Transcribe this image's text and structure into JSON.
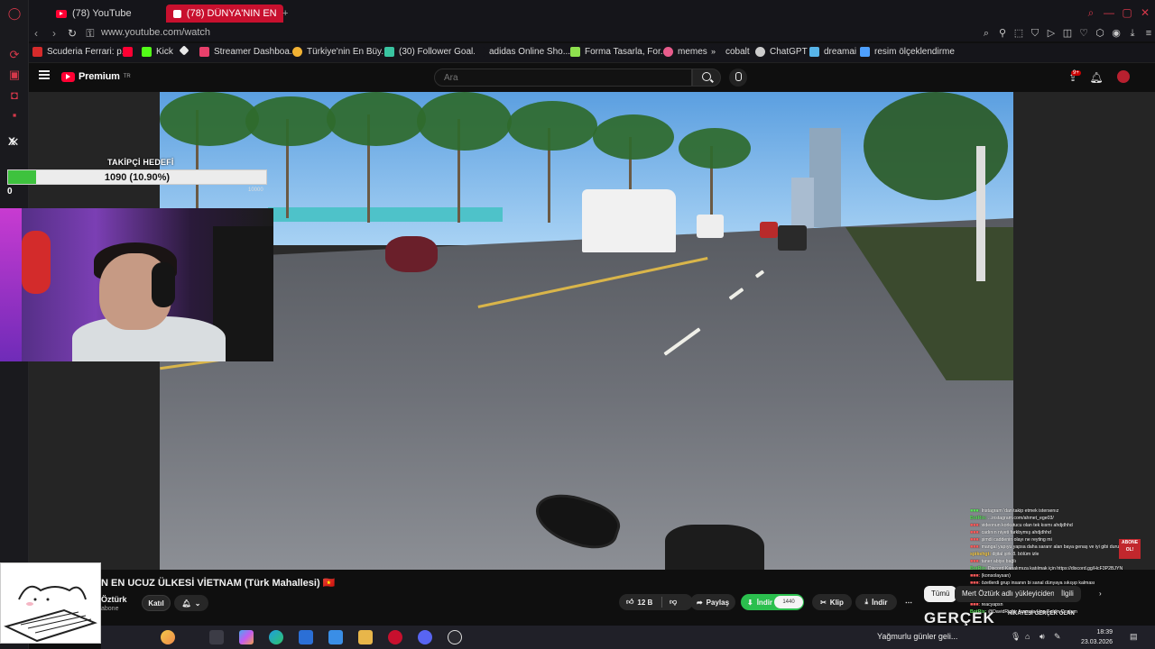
{
  "browser": {
    "tabs": [
      {
        "label": "(78) YouTube",
        "active": false
      },
      {
        "label": "(78) DÜNYA'NIN EN UCUZ",
        "active": true
      }
    ],
    "new_tab": "+",
    "url": "www.youtube.com/watch",
    "bookmarks": [
      {
        "label": "Scuderia Ferrari: p...",
        "color": "#d62b2b"
      },
      {
        "label": "",
        "color": "#ff0033"
      },
      {
        "label": "Kick",
        "color": "#53fc18"
      },
      {
        "label": "",
        "color": "#e8e8e8"
      },
      {
        "label": "Streamer Dashboa...",
        "color": "#e8406b"
      },
      {
        "label": "Türkiye'nin En Büy...",
        "color": "#f2b233"
      },
      {
        "label": "(30) Follower Goal...",
        "color": "#39c4a0"
      },
      {
        "label": "adidas Online Sho...",
        "color": "#111111"
      },
      {
        "label": "Forma Tasarla, For...",
        "color": "#8ee04e"
      },
      {
        "label": "memes",
        "color": "#e85c8c"
      },
      {
        "label": "cobalt",
        "color": "#dddddd"
      },
      {
        "label": "ChatGPT",
        "color": "#cccccc"
      },
      {
        "label": "dreamai",
        "color": "#57b4e8"
      },
      {
        "label": "resim ölçeklendirme",
        "color": "#4ea0ff"
      }
    ]
  },
  "youtube": {
    "logo_text": "Premium",
    "logo_sup": "TR",
    "search_placeholder": "Ara",
    "notif_count": "9+",
    "video": {
      "title": "N EN UCUZ ÜLKESİ VİETNAM (Türk Mahallesi) 🇻🇳",
      "channel": "Öztürk",
      "subs": "abone",
      "join_label": "Katıl",
      "likes": "12 B",
      "share_label": "Paylaş",
      "download_green_label": "İndir",
      "download_size": "1440",
      "clip_label": "Klip",
      "download_label": "İndir",
      "more_label": "⋯"
    },
    "chips": [
      "Tümü",
      "Mert Öztürk adlı yükleyiciden",
      "İlgili"
    ]
  },
  "overlay": {
    "goal_title": "TAKİPÇİ HEDEFİ",
    "goal_text": "1090 (10.90%)",
    "goal_fraction": 0.109,
    "goal_min": "0",
    "goal_max": "10000",
    "x_label": "X",
    "chat": [
      {
        "user": "",
        "text": "Instagram 'dan takip etmek istersenız",
        "color": "#5be05b"
      },
      {
        "user": "BotRix",
        "text": "...instagram.com/ahmet_ege03/",
        "color": "#5be05b"
      },
      {
        "user": "",
        "text": "videonun korkutucu olan tek kısmı ahdjdhhd",
        "color": "#ff5b5b"
      },
      {
        "user": "",
        "text": "cadının niyeti farkbymış ahdjdhhd",
        "color": "#ff5b5b"
      },
      {
        "user": "",
        "text": "şimdi caddenin olayı ne reyting mi",
        "color": "#ff5b5b"
      },
      {
        "user": "",
        "text": "mangal yapıyu yapsa daha sararır alan baya genaş ve iyi gibi duruyo",
        "color": "#ff5b5b"
      },
      {
        "user": "spikehgt",
        "text": "dijital şirk 8. bölüm izle",
        "color": "#ffd34d"
      },
      {
        "user": "",
        "text": "taner abiye bağlı",
        "color": "#ff5b5b"
      },
      {
        "user": "BotRix",
        "text": "Discord Kanalımıza katılmak için https://discord.gg/HcF3P2BJYN",
        "color": "#5be05b"
      },
      {
        "user": "",
        "text": "(konsolaysan)",
        "color": "#ff5b5b"
      },
      {
        "user": "",
        "text": "özetlerdi grup insanın bi sanal dünyaya sıkışıp kalması",
        "color": "#ff5b5b"
      },
      {
        "user": "",
        "text": "hikayesi gerçek olan",
        "color": "#ff5b5b"
      },
      {
        "user": "",
        "text": "baya iyidi bu",
        "color": "#ff5b5b"
      },
      {
        "user": "",
        "text": "reacyapsn",
        "color": "#ff5b5b"
      },
      {
        "user": "BotRix",
        "text": "@DavidRight: Aramıza Hoş Geldin Dostum",
        "color": "#5be05b"
      }
    ],
    "abone_label": "ABONE OL!",
    "gercek_logo": "GERÇEK",
    "gercek_sub": "HİKAYESİ GERÇEK OLAN"
  },
  "taskbar": {
    "weather": "Yağmurlu günler geli...",
    "time": "18:39",
    "date": "23.03.2026"
  },
  "colors": {
    "accent": "#ff0033",
    "opera_red": "#d4384a",
    "download_green": "#2bbf4e",
    "goal_green": "#3ec23e"
  }
}
